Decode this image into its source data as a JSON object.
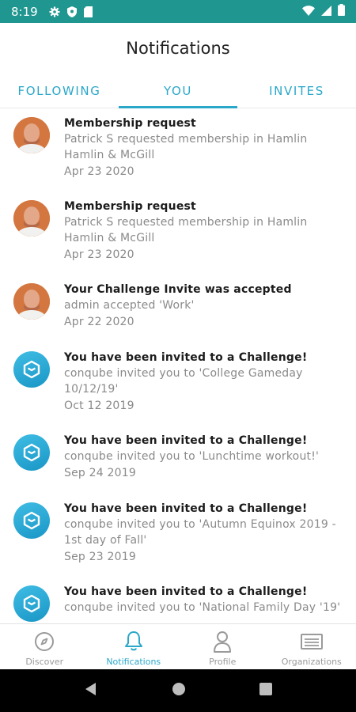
{
  "status_bar": {
    "time": "8:19"
  },
  "header": {
    "title": "Notifications"
  },
  "tabs": [
    {
      "label": "FOLLOWING"
    },
    {
      "label": "YOU"
    },
    {
      "label": "INVITES"
    }
  ],
  "notifications": [
    {
      "avatar": "user-photo",
      "title": "Membership request",
      "desc": "Patrick S requested membership in Hamlin Hamlin & McGill",
      "date": "Apr 23 2020"
    },
    {
      "avatar": "user-photo",
      "title": "Membership request",
      "desc": "Patrick S requested membership in Hamlin Hamlin & McGill",
      "date": "Apr 23 2020"
    },
    {
      "avatar": "user-photo",
      "title": "Your Challenge Invite was accepted",
      "desc": "admin accepted 'Work'",
      "date": "Apr 22 2020"
    },
    {
      "avatar": "app-logo",
      "title": "You have been invited to a Challenge!",
      "desc": "conqube invited you to 'College Gameday 10/12/19'",
      "date": "Oct 12 2019"
    },
    {
      "avatar": "app-logo",
      "title": "You have been invited to a Challenge!",
      "desc": "conqube invited you to 'Lunchtime workout!'",
      "date": "Sep 24 2019"
    },
    {
      "avatar": "app-logo",
      "title": "You have been invited to a Challenge!",
      "desc": "conqube invited you to 'Autumn Equinox 2019 - 1st day of Fall'",
      "date": "Sep 23 2019"
    },
    {
      "avatar": "app-logo",
      "title": "You have been invited to a Challenge!",
      "desc": "conqube invited you to 'National Family Day '19'",
      "date": ""
    }
  ],
  "bottom_nav": [
    {
      "label": "Discover",
      "icon": "compass-icon"
    },
    {
      "label": "Notifications",
      "icon": "bell-icon"
    },
    {
      "label": "Profile",
      "icon": "person-icon"
    },
    {
      "label": "Organizations",
      "icon": "building-list-icon"
    }
  ],
  "colors": {
    "status_bar": "#1f968f",
    "accent": "#2aa7c9",
    "inactive": "#9a9a9a"
  }
}
